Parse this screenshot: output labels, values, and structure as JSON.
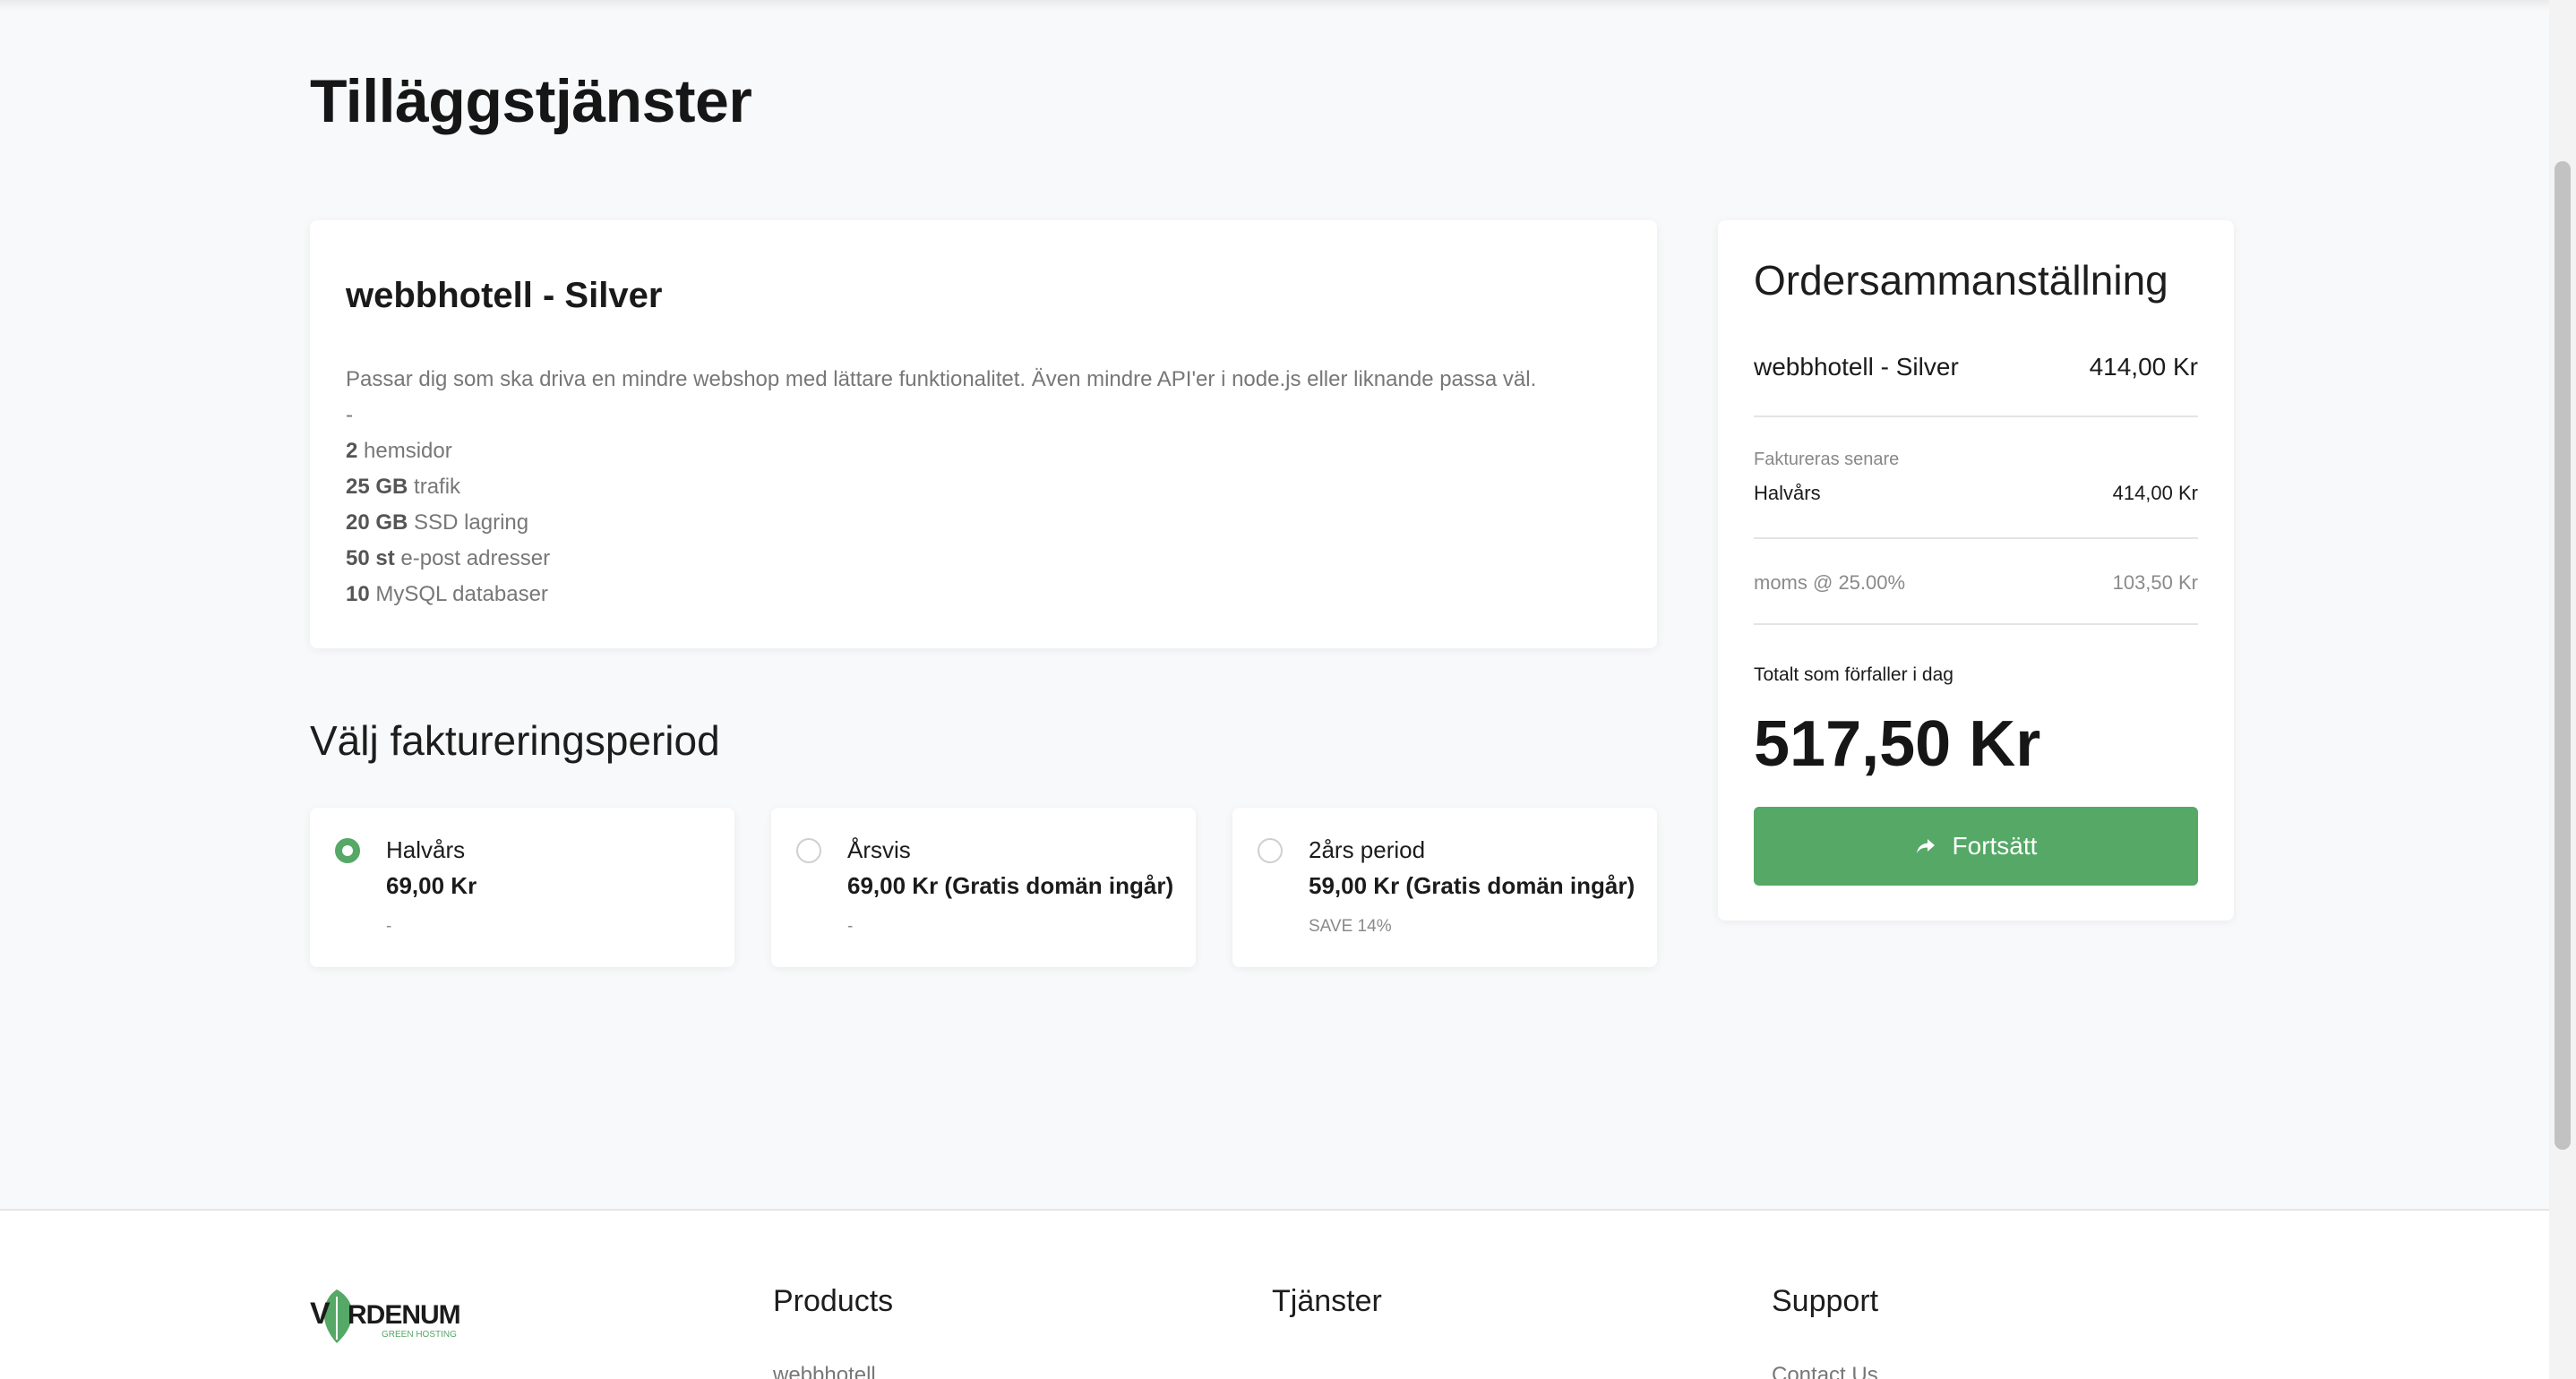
{
  "page_title": "Tilläggstjänster",
  "product": {
    "name": "webbhotell - Silver",
    "description": "Passar dig som ska driva en mindre webshop med lättare funktionalitet. Även mindre API'er i node.js eller liknande passa väl.",
    "separator": "-",
    "features": [
      {
        "value": "2",
        "label": "hemsidor"
      },
      {
        "value": "25 GB",
        "label": "trafik"
      },
      {
        "value": "20 GB",
        "label": "SSD lagring"
      },
      {
        "value": "50 st",
        "label": "e-post adresser"
      },
      {
        "value": "10",
        "label": "MySQL databaser"
      }
    ]
  },
  "billing": {
    "title": "Välj faktureringsperiod",
    "options": [
      {
        "name": "Halvårs",
        "price": "69,00 Kr",
        "note": "-",
        "selected": true
      },
      {
        "name": "Årsvis",
        "price": "69,00 Kr (Gratis domän ingår)",
        "note": "-",
        "selected": false
      },
      {
        "name": "2års period",
        "price": "59,00 Kr (Gratis domän ingår)",
        "note": "SAVE 14%",
        "selected": false
      }
    ]
  },
  "summary": {
    "title": "Ordersammanställning",
    "product_name": "webbhotell - Silver",
    "product_price": "414,00 Kr",
    "billed_later_label": "Faktureras senare",
    "billing_period": "Halvårs",
    "billing_period_price": "414,00 Kr",
    "tax_label": "moms @ 25.00%",
    "tax_amount": "103,50 Kr",
    "total_label": "Totalt som förfaller i dag",
    "total_amount": "517,50 Kr",
    "continue_label": "Fortsätt"
  },
  "footer": {
    "logo_text": "VERDENUM",
    "logo_subtext": "GREEN HOSTING",
    "columns": [
      {
        "title": "Products",
        "first_link": "webbhotell"
      },
      {
        "title": "Tjänster",
        "first_link": ""
      },
      {
        "title": "Support",
        "first_link": "Contact Us"
      }
    ]
  },
  "colors": {
    "accent": "#55a866",
    "background": "#f8f9fa",
    "card": "#ffffff"
  },
  "icons": {
    "continue_icon": "share-arrow-icon",
    "logo_leaf": "leaf-icon"
  }
}
